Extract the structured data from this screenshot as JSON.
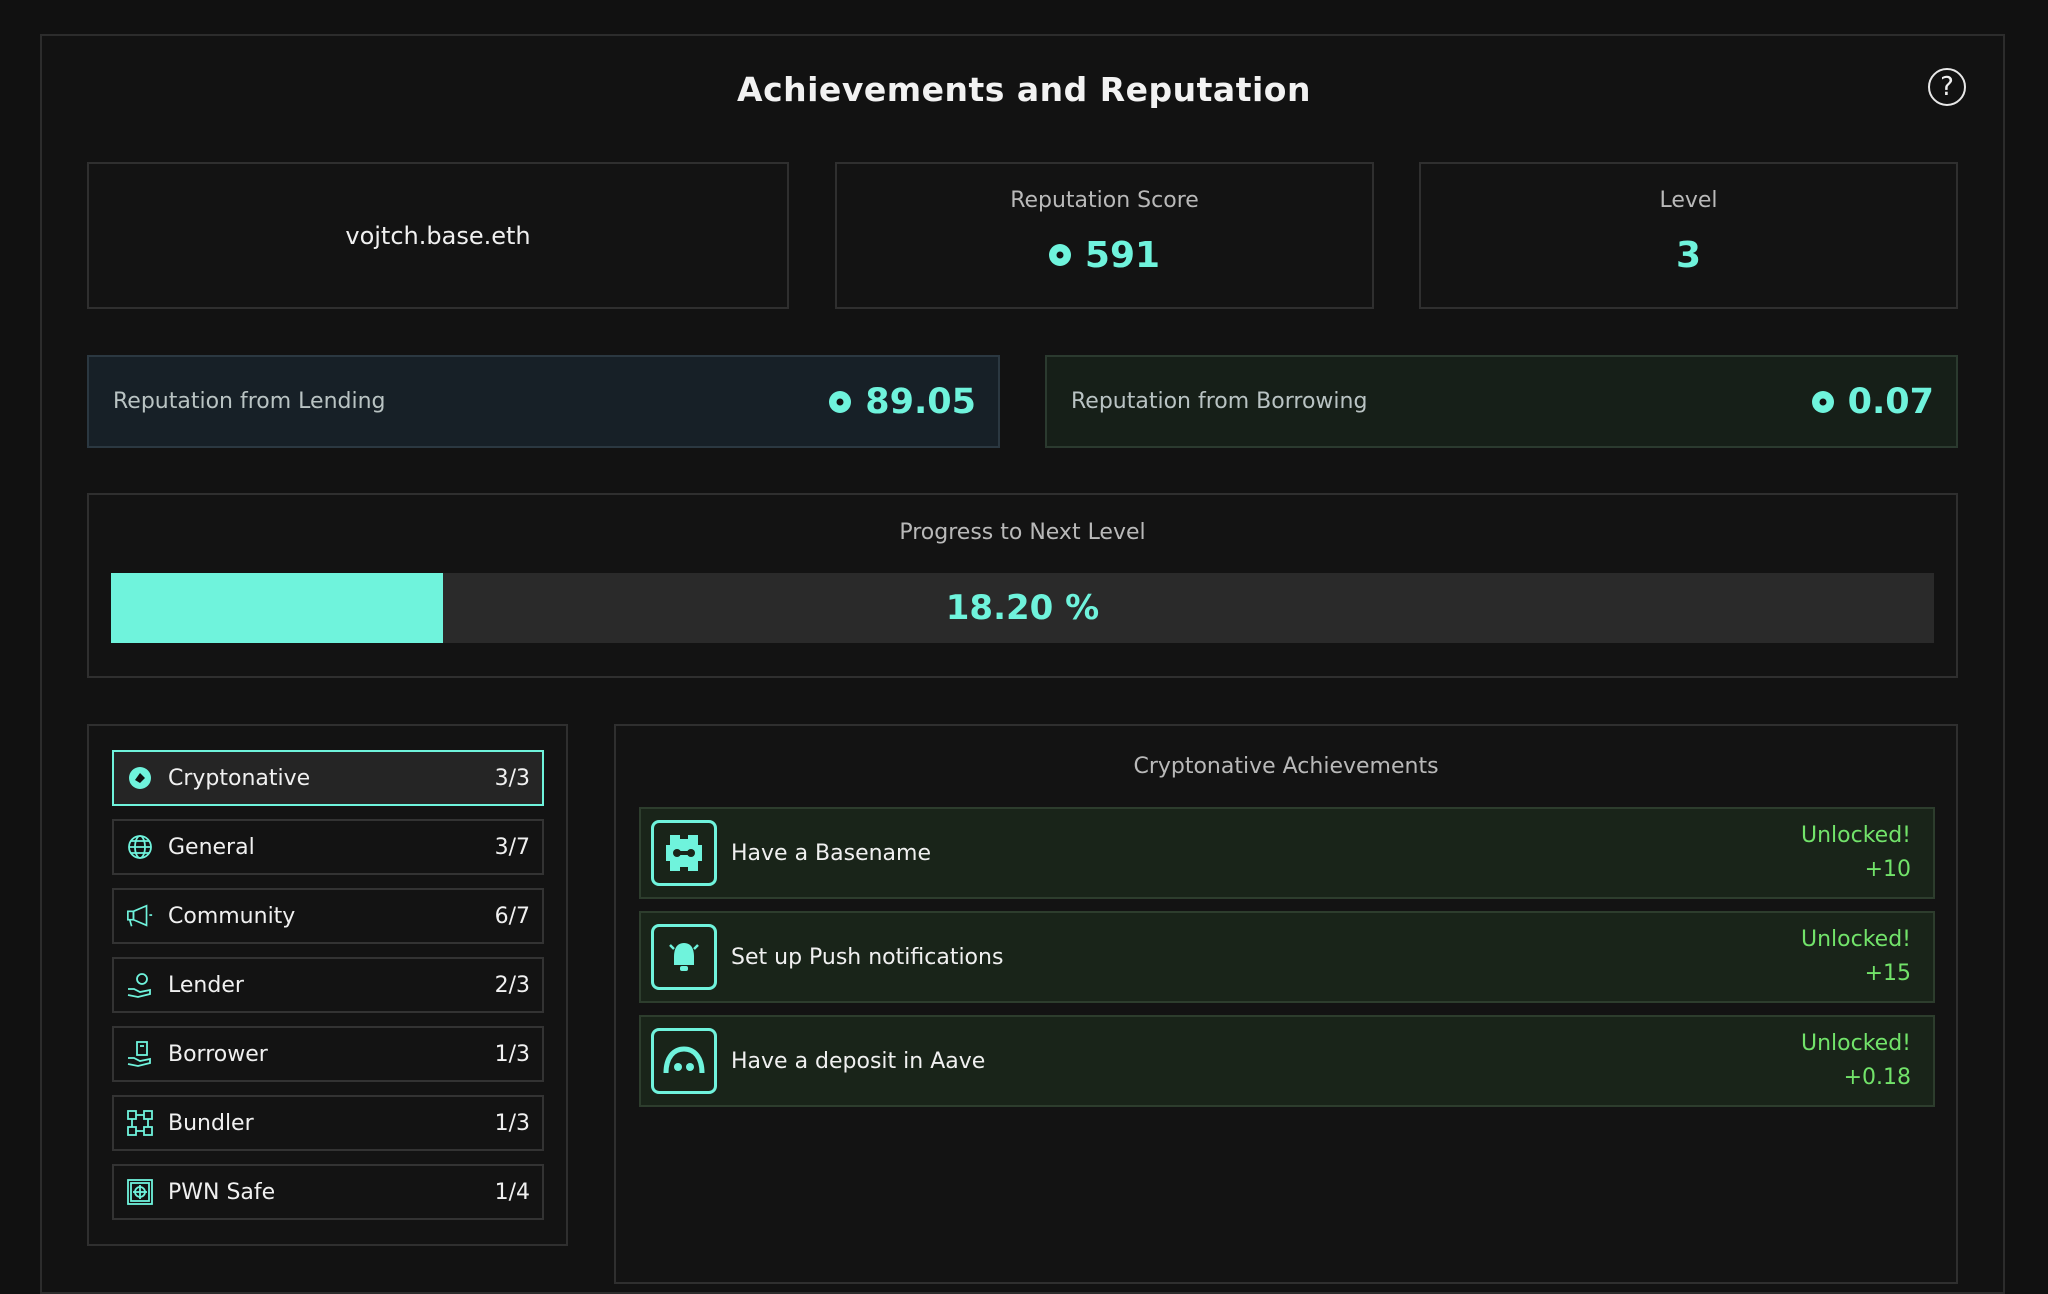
{
  "header": {
    "title": "Achievements and Reputation",
    "help_icon": "?"
  },
  "profile": {
    "name": "vojtch.base.eth"
  },
  "stats": {
    "reputation_label": "Reputation Score",
    "reputation_value": "591",
    "level_label": "Level",
    "level_value": "3"
  },
  "sources": {
    "lending_label": "Reputation from Lending",
    "lending_value": "89.05",
    "borrowing_label": "Reputation from Borrowing",
    "borrowing_value": "0.07"
  },
  "progress": {
    "label": "Progress to Next Level",
    "percent_text": "18.20 %",
    "percent": 18.2
  },
  "categories": [
    {
      "label": "Cryptonative",
      "count": "3/3",
      "icon": "coin-icon",
      "active": true
    },
    {
      "label": "General",
      "count": "3/7",
      "icon": "globe-icon"
    },
    {
      "label": "Community",
      "count": "6/7",
      "icon": "megaphone-icon"
    },
    {
      "label": "Lender",
      "count": "2/3",
      "icon": "hand-person-icon"
    },
    {
      "label": "Borrower",
      "count": "1/3",
      "icon": "hand-phone-icon"
    },
    {
      "label": "Bundler",
      "count": "1/3",
      "icon": "bundle-icon"
    },
    {
      "label": "PWN Safe",
      "count": "1/4",
      "icon": "safe-icon"
    }
  ],
  "achievements": {
    "title": "Cryptonative Achievements",
    "items": [
      {
        "label": "Have a Basename",
        "status": "Unlocked!",
        "points": "+10",
        "icon": "basename-icon"
      },
      {
        "label": "Set up Push notifications",
        "status": "Unlocked!",
        "points": "+15",
        "icon": "bell-icon"
      },
      {
        "label": "Have a deposit in Aave",
        "status": "Unlocked!",
        "points": "+0.18",
        "icon": "aave-icon"
      }
    ]
  },
  "colors": {
    "accent": "#6ff3dc",
    "unlocked": "#72e36a",
    "background": "#111111"
  }
}
